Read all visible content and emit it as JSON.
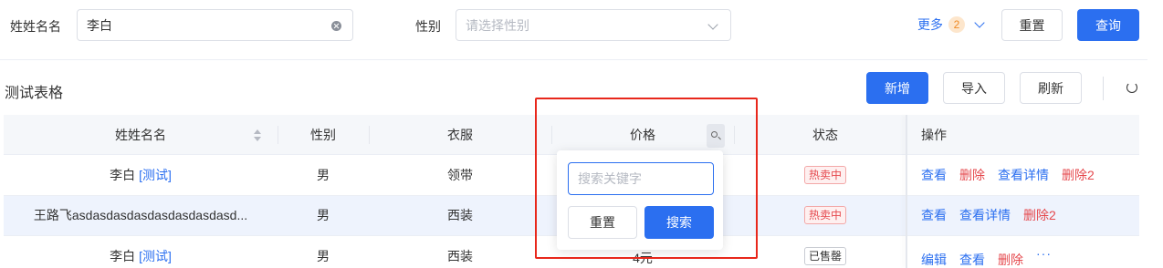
{
  "filter": {
    "name_label": "姓姓名名",
    "name_value": "李白",
    "gender_label": "性别",
    "gender_placeholder": "请选择性别",
    "more_label": "更多",
    "more_count": "2",
    "reset_label": "重置",
    "query_label": "查询"
  },
  "toolbar": {
    "title": "测试表格",
    "add_label": "新增",
    "import_label": "导入",
    "refresh_label": "刷新"
  },
  "table": {
    "headers": [
      "姓姓名名",
      "性别",
      "衣服",
      "价格",
      "状态",
      "操作"
    ],
    "rows": [
      {
        "name": "李白",
        "tag": "[测试]",
        "gender": "男",
        "cloth": "领带",
        "price": "",
        "status": "热卖中",
        "ops": [
          "查看",
          "删除",
          "查看详情",
          "删除2"
        ]
      },
      {
        "name": "王路飞asdasdasdasdasdasdasdasd...",
        "tag": "",
        "gender": "男",
        "cloth": "西装",
        "price": "",
        "status": "热卖中",
        "ops": [
          "查看",
          "查看详情",
          "删除2"
        ]
      },
      {
        "name": "李白",
        "tag": "[测试]",
        "gender": "男",
        "cloth": "西装",
        "price": "4元",
        "status": "已售罄",
        "ops": [
          "编辑",
          "查看",
          "删除"
        ],
        "more": "···"
      }
    ]
  },
  "popover": {
    "keyword_placeholder": "搜索关键字",
    "reset_label": "重置",
    "search_label": "搜索"
  },
  "colors": {
    "primary": "#2b6ff0",
    "danger": "#e5484d",
    "highlight_box": "#e8271b"
  }
}
